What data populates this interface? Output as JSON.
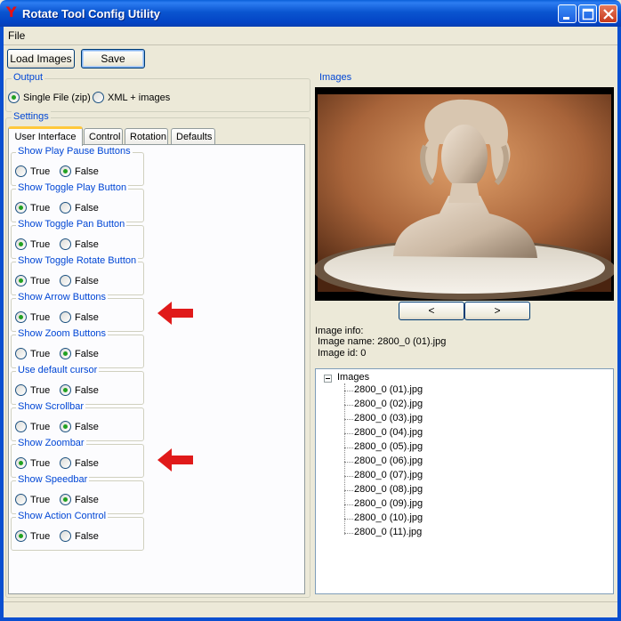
{
  "window": {
    "title": "Rotate Tool Config Utility",
    "icon": "app-logo-icon",
    "controls": [
      "minimize-icon",
      "maximize-icon",
      "close-icon"
    ]
  },
  "menu": {
    "file": "File"
  },
  "toolbar": {
    "load_label": "Load Images",
    "save_label": "Save"
  },
  "output": {
    "legend": "Output",
    "options": [
      {
        "label": "Single File (zip)",
        "selected": true
      },
      {
        "label": "XML + images",
        "selected": false
      }
    ]
  },
  "settings": {
    "legend": "Settings",
    "tabs": [
      "User Interface",
      "Control",
      "Rotation",
      "Defaults"
    ],
    "active_tab": "User Interface",
    "true_label": "True",
    "false_label": "False",
    "items": [
      {
        "label": "Show Play Pause Buttons",
        "value": false
      },
      {
        "label": "Show Toggle Play Button",
        "value": true
      },
      {
        "label": "Show Toggle Pan Button",
        "value": true
      },
      {
        "label": "Show Toggle Rotate Button",
        "value": true
      },
      {
        "label": "Show Arrow Buttons",
        "value": true
      },
      {
        "label": "Show Zoom Buttons",
        "value": false
      },
      {
        "label": "Use default cursor",
        "value": false
      },
      {
        "label": "Show Scrollbar",
        "value": false
      },
      {
        "label": "Show Zoombar",
        "value": true
      },
      {
        "label": "Show Speedbar",
        "value": false
      },
      {
        "label": "Show Action Control",
        "value": true
      }
    ]
  },
  "images": {
    "legend": "Images",
    "prev_label": "<",
    "next_label": ">",
    "info_title": "Image info:",
    "info_name": "Image name: 2800_0 (01).jpg",
    "info_id": "Image id: 0",
    "tree_root": "Images",
    "files": [
      "2800_0 (01).jpg",
      "2800_0 (02).jpg",
      "2800_0 (03).jpg",
      "2800_0 (04).jpg",
      "2800_0 (05).jpg",
      "2800_0 (06).jpg",
      "2800_0 (07).jpg",
      "2800_0 (08).jpg",
      "2800_0 (09).jpg",
      "2800_0 (10).jpg",
      "2800_0 (11).jpg"
    ]
  },
  "colors": {
    "accent": "#0046d5",
    "arrow": "#e01a1a",
    "titlebar": "#0a55d0"
  }
}
